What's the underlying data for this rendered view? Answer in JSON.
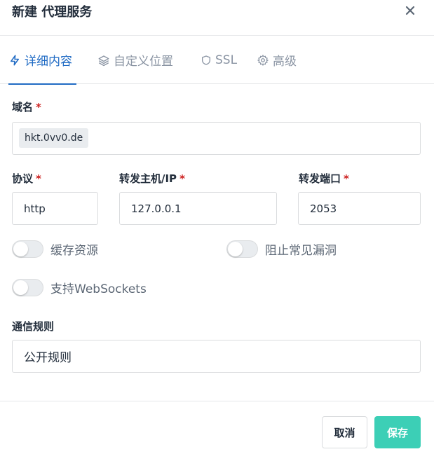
{
  "dialog": {
    "title": "新建 代理服务"
  },
  "tabs": [
    {
      "label": "详细内容",
      "icon": "lightning-icon",
      "active": true
    },
    {
      "label": "自定义位置",
      "icon": "layers-icon",
      "active": false
    },
    {
      "label": "SSL",
      "icon": "shield-icon",
      "active": false
    },
    {
      "label": "高级",
      "icon": "gear-icon",
      "active": false
    }
  ],
  "form": {
    "domain": {
      "label": "域名",
      "required": "*",
      "value": "hkt.0vv0.de"
    },
    "scheme": {
      "label": "协议",
      "required": "*",
      "value": "http"
    },
    "forward_host": {
      "label": "转发主机/IP",
      "required": "*",
      "value": "127.0.0.1"
    },
    "forward_port": {
      "label": "转发端口",
      "required": "*",
      "value": "2053"
    },
    "toggles": {
      "cache": {
        "label": "缓存资源",
        "on": false
      },
      "block_exploits": {
        "label": "阻止常见漏洞",
        "on": false
      },
      "websockets": {
        "label": "支持WebSockets",
        "on": false
      }
    },
    "access_list": {
      "label": "通信规则",
      "value": "公开规则"
    }
  },
  "footer": {
    "cancel_label": "取消",
    "save_label": "保存"
  },
  "colors": {
    "accent": "#206bc4",
    "save_button": "#3ccfb6",
    "required": "#cd201f"
  }
}
